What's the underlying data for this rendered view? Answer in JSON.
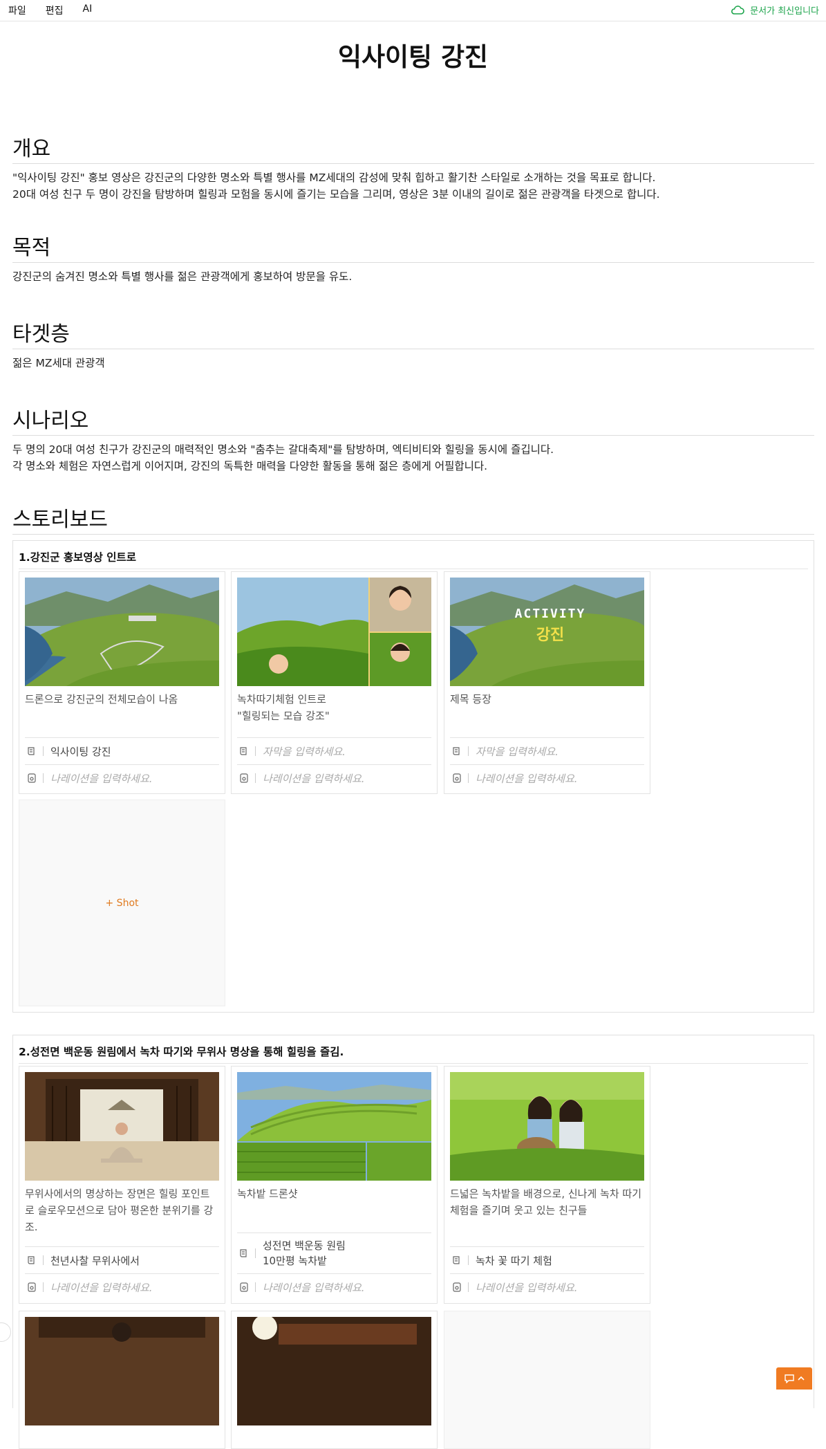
{
  "menu": {
    "file": "파일",
    "edit": "편집",
    "ai": "AI"
  },
  "status": {
    "text": "문서가 최신입니다",
    "color": "#1aa34a",
    "icon": "cloud-icon"
  },
  "document": {
    "title": "익사이팅 강진"
  },
  "sections": {
    "overview": {
      "heading": "개요",
      "lines": [
        "\"익사이팅 강진\" 홍보 영상은 강진군의 다양한 명소와 특별 행사를 MZ세대의 감성에 맞춰 힙하고 활기찬 스타일로 소개하는 것을 목표로 합니다.",
        "20대 여성 친구 두 명이 강진을 탐방하며 힐링과 모험을 동시에 즐기는 모습을 그리며, 영상은 3분 이내의 길이로 젊은 관광객을 타겟으로 합니다."
      ]
    },
    "purpose": {
      "heading": "목적",
      "lines": [
        "강진군의 숨겨진 명소와 특별 행사를 젊은 관광객에게 홍보하여 방문을 유도."
      ]
    },
    "target": {
      "heading": "타겟층",
      "lines": [
        "젊은 MZ세대 관광객"
      ]
    },
    "scenario": {
      "heading": "시나리오",
      "lines": [
        "두 명의 20대 여성 친구가 강진군의 매력적인 명소와 \"춤추는 갈대축제\"를 탐방하며, 엑티비티와 힐링을 동시에 즐깁니다.",
        "각 명소와 체험은 자연스럽게 이어지며, 강진의 독특한 매력을 다양한 활동을 통해 젊은 층에게 어필합니다."
      ]
    },
    "storyboard": {
      "heading": "스토리보드"
    }
  },
  "scenes": [
    {
      "title": "1.강진군 홍보영상 인트로",
      "shots": [
        {
          "desc": "드론으로 강진군의 전체모습이 나옴",
          "subtitle": "익사이팅 강진",
          "narration": "나레이션을 입력하세요."
        },
        {
          "desc": "녹차따기체험 인트로\n\"힐링되는 모습 강조\"",
          "subtitle": "자막을 입력하세요.",
          "narration": "나레이션을 입력하세요."
        },
        {
          "desc": "제목 등장",
          "subtitle": "자막을 입력하세요.",
          "narration": "나레이션을 입력하세요.",
          "overlay_top": "ACTIVITY",
          "overlay_bottom": "강진"
        }
      ],
      "add_label": "+ Shot"
    },
    {
      "title": "2.성전면 백운동 원림에서 녹차 따기와 무위사 명상을 통해 힐링을 즐김.",
      "shots": [
        {
          "desc": "무위사에서의 명상하는 장면은 힐링 포인트로 슬로우모션으로 담아 평온한 분위기를 강조.",
          "subtitle": "천년사찰 무위사에서",
          "narration": "나레이션을 입력하세요."
        },
        {
          "desc": "녹차밭 드론샷",
          "subtitle": "성전면 백운동 원림\n10만평 녹차밭",
          "narration": "나레이션을 입력하세요."
        },
        {
          "desc": "드넓은 녹차밭을 배경으로, 신나게 녹차 따기 체험을 즐기며 웃고 있는 친구들",
          "subtitle": "녹차 꽃 따기 체험",
          "narration": "나레이션을 입력하세요."
        }
      ]
    }
  ],
  "icons": {
    "subtitle": "script-icon",
    "narration": "microphone-icon",
    "chat": "chat-icon"
  },
  "colors": {
    "accent": "#f07b22",
    "status": "#1aa34a"
  }
}
